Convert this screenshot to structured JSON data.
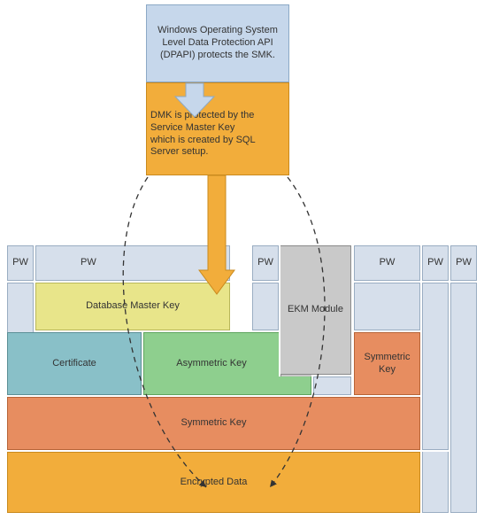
{
  "top1": "Windows Operating System Level Data Protection API (DPAPI) protects the SMK.",
  "top2": "DMK is protected by the Service Master Key which is created by SQL Server setup.",
  "pw": {
    "a": "PW",
    "b": "PW",
    "c": "PW",
    "d": "PW",
    "e": "PW",
    "f": "PW"
  },
  "dmk": "Database Master Key",
  "ekm": "EKM Module",
  "cert": "Certificate",
  "asym": "Asymmetric Key",
  "sym": "Symmetric Key",
  "sym2": "Symmetric Key",
  "encd": "Encrypted Data"
}
